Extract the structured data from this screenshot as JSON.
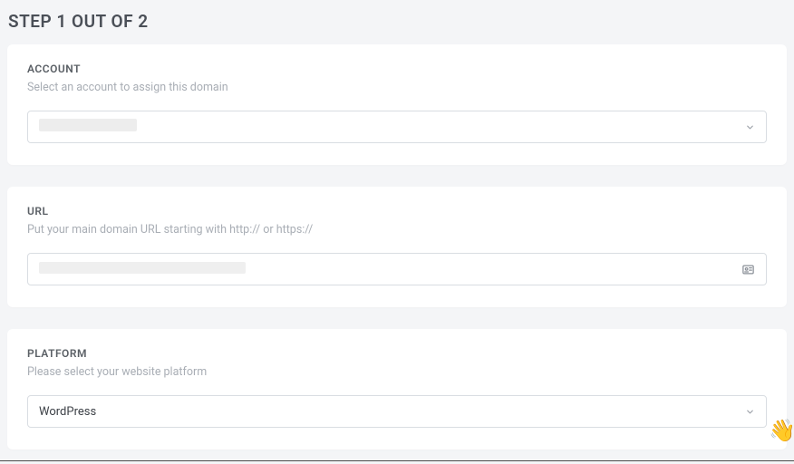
{
  "header": {
    "step_title": "STEP 1 OUT OF 2"
  },
  "account": {
    "label": "ACCOUNT",
    "sublabel": "Select an account to assign this domain",
    "selected_value": ""
  },
  "url": {
    "label": "URL",
    "sublabel": "Put your main domain URL starting with http:// or https://",
    "value": ""
  },
  "platform": {
    "label": "PLATFORM",
    "sublabel": "Please select your website platform",
    "selected_value": "WordPress"
  },
  "widget": {
    "emoji": "👋"
  }
}
